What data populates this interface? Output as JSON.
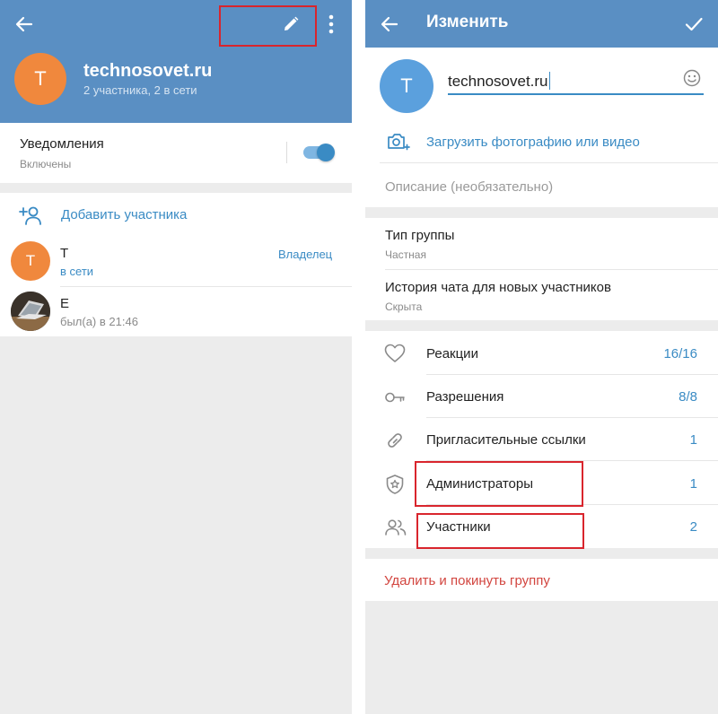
{
  "colors": {
    "header_blue": "#5a8fc3",
    "accent": "#3a8bc4",
    "avatar_orange": "#f0883d",
    "avatar_blue": "#5ba0dd",
    "danger": "#d2453f",
    "highlight_box": "#d9252d"
  },
  "left": {
    "header": {
      "back_icon": "arrow-left-icon",
      "edit_icon": "pencil-icon",
      "more_icon": "more-vertical-icon",
      "avatar_letter": "T",
      "title": "technosovet.ru",
      "subtitle": "2 участника, 2 в сети"
    },
    "notifications": {
      "label": "Уведомления",
      "status": "Включены",
      "toggle_on": true
    },
    "add_member": {
      "icon": "add-user-icon",
      "label": "Добавить участника"
    },
    "members": [
      {
        "avatar_letter": "T",
        "name": "T",
        "status": "в сети",
        "role": "Владелец"
      },
      {
        "avatar": "laptop-photo",
        "name": "E",
        "status": "был(а) в 21:46",
        "role": ""
      }
    ]
  },
  "right": {
    "header": {
      "back_icon": "arrow-left-icon",
      "title": "Изменить",
      "confirm_icon": "check-icon"
    },
    "profile": {
      "avatar_letter": "T",
      "name_value": "technosovet.ru",
      "emoji_icon": "smile-icon",
      "upload_icon": "camera-plus-icon",
      "upload_label": "Загрузить фотографию или видео",
      "description_placeholder": "Описание (необязательно)"
    },
    "group_type": {
      "label": "Тип группы",
      "value": "Частная"
    },
    "history": {
      "label": "История чата для новых участников",
      "value": "Скрыта"
    },
    "settings": [
      {
        "icon": "heart-icon",
        "label": "Реакции",
        "value": "16/16"
      },
      {
        "icon": "key-icon",
        "label": "Разрешения",
        "value": "8/8"
      },
      {
        "icon": "link-icon",
        "label": "Пригласительные ссылки",
        "value": "1"
      },
      {
        "icon": "shield-star-icon",
        "label": "Администраторы",
        "value": "1"
      },
      {
        "icon": "users-icon",
        "label": "Участники",
        "value": "2"
      }
    ],
    "delete_label": "Удалить и покинуть группу"
  }
}
